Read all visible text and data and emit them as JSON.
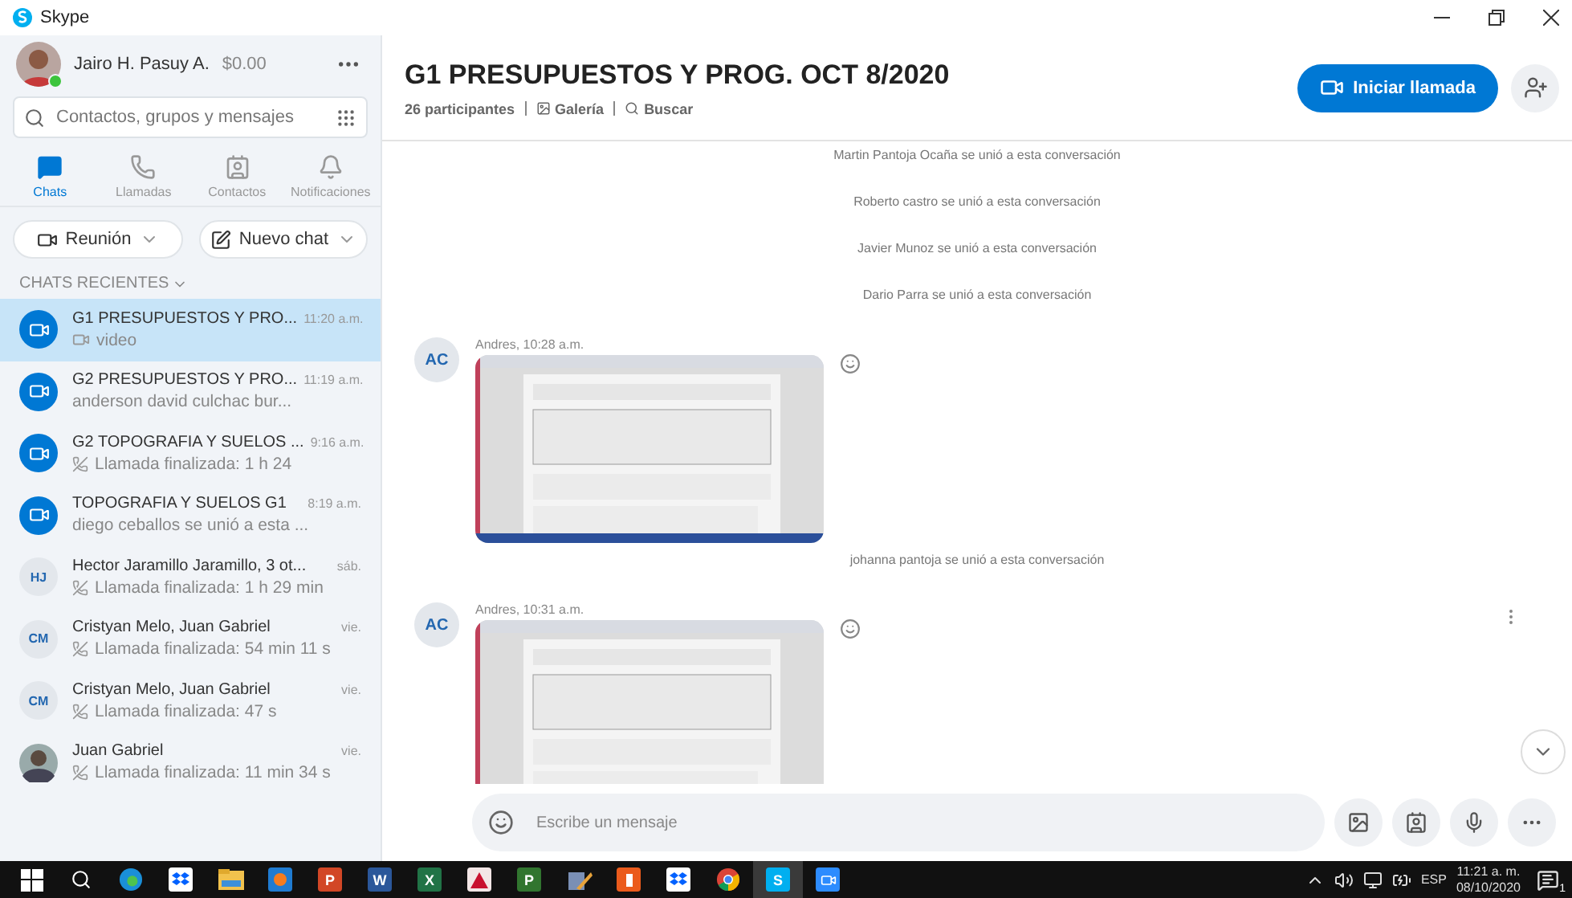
{
  "window": {
    "title": "Skype"
  },
  "profile": {
    "name": "Jairo H. Pasuy A.",
    "credit": "$0.00",
    "online": true
  },
  "search": {
    "placeholder": "Contactos, grupos y mensajes"
  },
  "nav_tabs": [
    {
      "label": "Chats",
      "selected": true
    },
    {
      "label": "Llamadas",
      "selected": false
    },
    {
      "label": "Contactos",
      "selected": false
    },
    {
      "label": "Notificaciones",
      "selected": false
    }
  ],
  "actions": [
    {
      "label": "Reunión"
    },
    {
      "label": "Nuevo chat"
    }
  ],
  "recent_header": "CHATS RECIENTES",
  "chats": [
    {
      "kind": "group",
      "title": "G1 PRESUPUESTOS Y PRO...",
      "time": "11:20 a.m.",
      "preview": {
        "kind": "video",
        "text": "video"
      },
      "selected": true
    },
    {
      "kind": "group",
      "title": "G2 PRESUPUESTOS Y PRO...",
      "time": "11:19 a.m.",
      "preview": {
        "kind": "text",
        "text": "anderson david culchac bur..."
      },
      "selected": false
    },
    {
      "kind": "group",
      "title": "G2 TOPOGRAFIA Y SUELOS ...",
      "time": "9:16 a.m.",
      "preview": {
        "kind": "call",
        "text": "Llamada finalizada: 1 h 24"
      },
      "selected": false
    },
    {
      "kind": "group",
      "title": "TOPOGRAFIA Y SUELOS G1",
      "time": "8:19 a.m.",
      "preview": {
        "kind": "text",
        "text": "diego ceballos se unió a esta ..."
      },
      "selected": false
    },
    {
      "kind": "initials",
      "initials": "HJ",
      "title": "Hector Jaramillo Jaramillo,  3 ot...",
      "time": "sáb.",
      "preview": {
        "kind": "call",
        "text": "Llamada finalizada: 1 h 29 min"
      },
      "selected": false
    },
    {
      "kind": "initials",
      "initials": "CM",
      "title": "Cristyan Melo, Juan Gabriel",
      "time": "vie.",
      "preview": {
        "kind": "call",
        "text": "Llamada finalizada: 54 min 11 s"
      },
      "selected": false
    },
    {
      "kind": "initials",
      "initials": "CM",
      "title": "Cristyan Melo, Juan Gabriel",
      "time": "vie.",
      "preview": {
        "kind": "call",
        "text": "Llamada finalizada: 47 s"
      },
      "selected": false
    },
    {
      "title": "Juan Gabriel",
      "time": "vie.",
      "preview": {
        "kind": "call",
        "text": "Llamada finalizada: 11 min 34 s"
      },
      "selected": false
    }
  ],
  "conversation": {
    "title": "G1 PRESUPUESTOS Y PROG. OCT 8/2020",
    "participants": "26 participantes",
    "gallery": "Galería",
    "search": "Buscar",
    "call_button": "Iniciar llamada"
  },
  "events": [
    {
      "kind": "system",
      "text": "Martin Pantoja Ocaña se unió a esta conversación"
    },
    {
      "kind": "system",
      "text": "Roberto castro se unió a esta conversación"
    },
    {
      "kind": "system",
      "text": "Javier Munoz se unió a esta conversación"
    },
    {
      "kind": "system",
      "text": "Dario Parra se unió a esta conversación"
    },
    {
      "kind": "message",
      "initials": "AC",
      "header": "Andres, 10:28 a.m.",
      "menu": false
    },
    {
      "kind": "system",
      "text": "johanna pantoja se unió a esta conversación"
    },
    {
      "kind": "message",
      "initials": "AC",
      "header": "Andres, 10:31 a.m.",
      "menu": true
    }
  ],
  "composer": {
    "placeholder": "Escribe un mensaje"
  },
  "taskbar": {
    "apps": [
      {
        "kind": "windows"
      },
      {
        "kind": "search"
      },
      {
        "kind": "edge"
      },
      {
        "kind": "dropbox"
      },
      {
        "kind": "folder"
      },
      {
        "kind": "media"
      },
      {
        "kind": "letter",
        "glyph": "P",
        "color": "#d24726"
      },
      {
        "kind": "letter",
        "glyph": "W",
        "color": "#2b579a"
      },
      {
        "kind": "letter",
        "glyph": "X",
        "color": "#217346"
      },
      {
        "kind": "acrobat"
      },
      {
        "kind": "letter",
        "glyph": "P",
        "color": "#31752f"
      },
      {
        "kind": "tool"
      },
      {
        "kind": "office"
      },
      {
        "kind": "dropbox"
      },
      {
        "kind": "chrome"
      },
      {
        "kind": "letter",
        "glyph": "S",
        "color": "#00aff0",
        "active": true
      },
      {
        "kind": "zoom"
      }
    ],
    "language": "ESP",
    "time": "11:21 a. m.",
    "date": "08/10/2020",
    "notifications": "1"
  }
}
